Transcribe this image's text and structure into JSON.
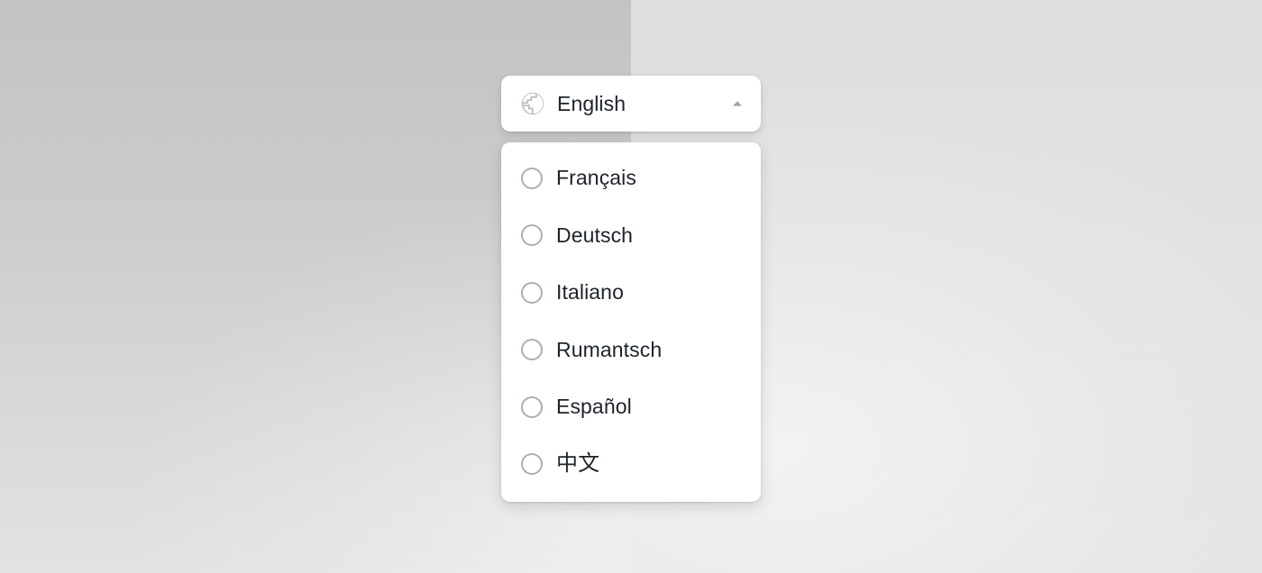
{
  "background": {
    "left_panel_color": "#c9c9ca",
    "right_panel_color": "#e2e2e2"
  },
  "language_select": {
    "name": "language-selector",
    "expanded": true,
    "globe_icon": "globe-icon",
    "caret_icon": "caret-up-icon",
    "selected_label": "English",
    "selected_value": "en",
    "accent_color": "#a9afb7",
    "text_color": "#1e232b",
    "surface_color": "#ffffff",
    "options": [
      {
        "label": "Français",
        "value": "fr",
        "selected": false,
        "radio_icon": "radio-unchecked-icon"
      },
      {
        "label": "Deutsch",
        "value": "de",
        "selected": false,
        "radio_icon": "radio-unchecked-icon"
      },
      {
        "label": "Italiano",
        "value": "it",
        "selected": false,
        "radio_icon": "radio-unchecked-icon"
      },
      {
        "label": "Rumantsch",
        "value": "rm",
        "selected": false,
        "radio_icon": "radio-unchecked-icon"
      },
      {
        "label": "Español",
        "value": "es",
        "selected": false,
        "radio_icon": "radio-unchecked-icon"
      },
      {
        "label": "中文",
        "value": "zh",
        "selected": false,
        "radio_icon": "radio-unchecked-icon"
      }
    ]
  }
}
